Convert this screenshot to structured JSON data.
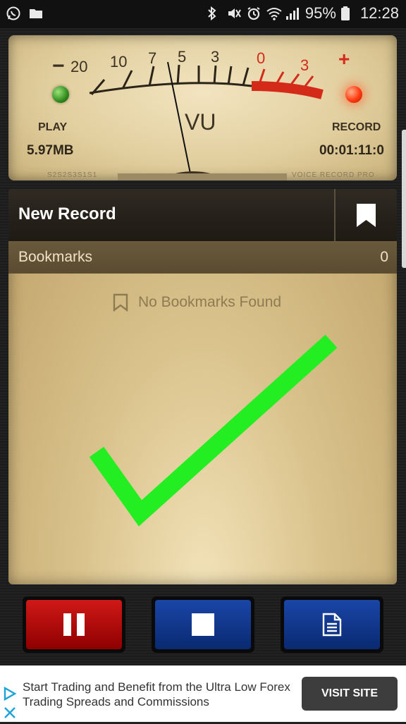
{
  "status_bar": {
    "battery": "95%",
    "time": "12:28",
    "left_icons": [
      "whatsapp-icon",
      "folder-icon"
    ],
    "right_icons": [
      "bluetooth-icon",
      "mute-icon",
      "alarm-icon",
      "wifi-icon",
      "signal-icon",
      "battery-icon"
    ]
  },
  "vu_meter": {
    "scale_labels": [
      "−",
      "20",
      "10",
      "7",
      "5",
      "3",
      "0",
      "3",
      "+"
    ],
    "title": "VU",
    "play_label": "PLAY",
    "record_label": "RECORD",
    "size": "5.97MB",
    "elapsed": "00:01:11:0",
    "engrave_left": "S2S2S3S1S1",
    "engrave_right": "VOICE RECORD PRO",
    "colors": {
      "red_zone": "#d42a1a",
      "needle": "#111111"
    }
  },
  "record": {
    "title": "New Record",
    "bookmarks_label": "Bookmarks",
    "bookmarks_count": "0",
    "empty_message": "No Bookmarks Found"
  },
  "controls": {
    "pause_icon": "pause-icon",
    "stop_icon": "stop-icon",
    "doc_icon": "document-icon"
  },
  "ad": {
    "text": "Start Trading and Benefit from the Ultra Low Forex Trading Spreads and Commissions",
    "button": "VISIT SITE",
    "icons": [
      "adchoices-icon",
      "close-icon"
    ]
  }
}
